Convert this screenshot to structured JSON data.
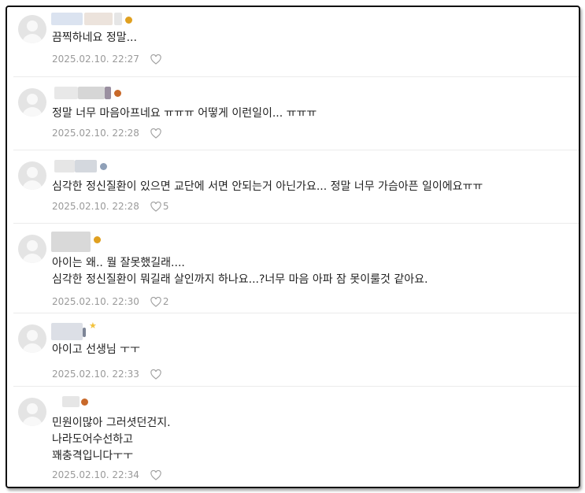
{
  "comments": [
    {
      "text": "끔찍하네요 정말...",
      "date": "2025.02.10.  22:27",
      "likes": ""
    },
    {
      "text": "정말 너무 마음아프네요 ㅠㅠㅠ 어떻게 이런일이... ㅠㅠㅠ",
      "date": "2025.02.10.  22:28",
      "likes": ""
    },
    {
      "text": "심각한 정신질환이 있으면 교단에 서면 안되는거 아닌가요... 정말 너무 가슴아픈 일이에요ㅠㅠ",
      "date": "2025.02.10.  22:28",
      "likes": "5"
    },
    {
      "text": "아이는 왜.. 뭘 잘못했길래....\n심각한 정신질환이 뭐길래 살인까지 하나요...?너무 마음 아파 잠 못이룰것 같아요.",
      "date": "2025.02.10.  22:30",
      "likes": "2"
    },
    {
      "text": "아이고 선생님 ㅜㅜ",
      "date": "2025.02.10.  22:33",
      "likes": ""
    },
    {
      "text": "민원이많아 그러셧던건지.\n나라도어수선하고\n꽤충격입니다ㅜㅜ",
      "date": "2025.02.10.  22:34",
      "likes": ""
    }
  ],
  "colors": {
    "badge_gold": "#e0a020",
    "badge_bronze": "#c8692a",
    "badge_silver": "#8fa0b8",
    "star": "#f2c23a",
    "heart": "#a0a0a0"
  },
  "icons": {
    "avatar": "default-user-silhouette",
    "like": "heart-outline-icon",
    "badge": "medal-icon",
    "star": "star-icon"
  }
}
